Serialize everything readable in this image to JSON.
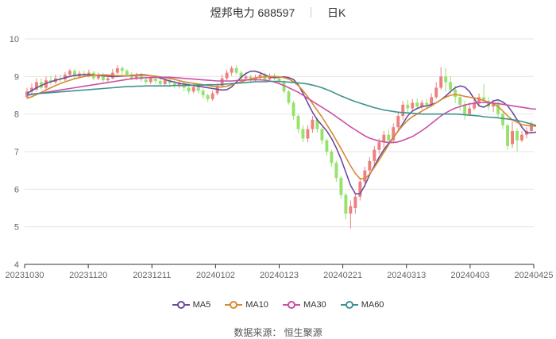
{
  "header": {
    "name": "煜邦电力",
    "code": "688597",
    "period": "日K"
  },
  "source": "数据来源： 恒生聚源",
  "colors": {
    "up": "#ee7f7f",
    "down": "#95e36b",
    "MA5": "#6a4c9c",
    "MA10": "#d9892f",
    "MA30": "#cc4fa6",
    "MA60": "#3f9290",
    "grid": "#e6e6e6",
    "axis": "#666666"
  },
  "chart_data": {
    "type": "candlestick",
    "title": "煜邦电力 688597 日K",
    "x_ticks": [
      "20231030",
      "20231120",
      "20231211",
      "20240102",
      "20240123",
      "20240221",
      "20240313",
      "20240403",
      "20240425"
    ],
    "ylim": [
      4,
      10
    ],
    "y_ticks": [
      4,
      5,
      6,
      7,
      8,
      9,
      10
    ],
    "grid": true,
    "legend_position": "bottom",
    "series": [
      {
        "name": "MA5",
        "values": [
          8.55,
          8.62,
          8.7,
          8.76,
          8.82,
          8.86,
          8.9,
          8.93,
          8.97,
          9.0,
          9.03,
          9.04,
          9.05,
          9.05,
          9.04,
          9.03,
          9.02,
          9.01,
          9.0,
          9.0,
          9.01,
          9.02,
          9.03,
          9.04,
          9.05,
          9.04,
          9.02,
          8.99,
          8.96,
          8.92,
          8.88,
          8.85,
          8.82,
          8.8,
          8.78,
          8.76,
          8.74,
          8.72,
          8.7,
          8.68,
          8.66,
          8.64,
          8.65,
          8.72,
          8.85,
          8.98,
          9.08,
          9.14,
          9.14,
          9.1,
          9.04,
          8.99,
          8.97,
          8.98,
          8.99,
          8.97,
          8.92,
          8.78,
          8.55,
          8.3,
          8.05,
          7.85,
          7.7,
          7.55,
          7.35,
          7.1,
          6.8,
          6.45,
          6.1,
          5.88,
          5.88,
          6.1,
          6.38,
          6.62,
          6.85,
          7.05,
          7.22,
          7.38,
          7.55,
          7.75,
          7.95,
          8.08,
          8.15,
          8.2,
          8.22,
          8.25,
          8.3,
          8.38,
          8.48,
          8.6,
          8.7,
          8.75,
          8.72,
          8.6,
          8.4,
          8.22,
          8.18,
          8.25,
          8.35,
          8.38,
          8.32,
          8.22,
          8.05,
          7.85,
          7.65,
          7.5,
          7.5,
          7.52
        ]
      },
      {
        "name": "MA10",
        "values": [
          8.42,
          8.46,
          8.52,
          8.58,
          8.64,
          8.7,
          8.76,
          8.81,
          8.86,
          8.9,
          8.94,
          8.97,
          9.0,
          9.02,
          9.03,
          9.04,
          9.04,
          9.04,
          9.03,
          9.02,
          9.02,
          9.02,
          9.02,
          9.03,
          9.03,
          9.03,
          9.02,
          9.01,
          8.99,
          8.97,
          8.95,
          8.92,
          8.89,
          8.86,
          8.84,
          8.82,
          8.8,
          8.78,
          8.76,
          8.74,
          8.72,
          8.72,
          8.74,
          8.78,
          8.82,
          8.86,
          8.9,
          8.93,
          8.96,
          8.98,
          8.99,
          9.0,
          9.0,
          8.99,
          8.97,
          8.93,
          8.86,
          8.76,
          8.62,
          8.46,
          8.28,
          8.1,
          7.92,
          7.72,
          7.52,
          7.3,
          7.08,
          6.85,
          6.62,
          6.42,
          6.28,
          6.28,
          6.4,
          6.58,
          6.78,
          6.98,
          7.18,
          7.38,
          7.55,
          7.7,
          7.83,
          7.93,
          8.0,
          8.08,
          8.15,
          8.22,
          8.3,
          8.38,
          8.45,
          8.5,
          8.52,
          8.5,
          8.47,
          8.45,
          8.43,
          8.4,
          8.36,
          8.32,
          8.28,
          8.2,
          8.08,
          7.95,
          7.85,
          7.78,
          7.72,
          7.7,
          7.68,
          7.68
        ]
      },
      {
        "name": "MA30",
        "values": [
          8.5,
          8.52,
          8.54,
          8.56,
          8.58,
          8.6,
          8.62,
          8.64,
          8.66,
          8.68,
          8.7,
          8.72,
          8.74,
          8.76,
          8.78,
          8.8,
          8.82,
          8.84,
          8.86,
          8.88,
          8.9,
          8.92,
          8.94,
          8.95,
          8.96,
          8.97,
          8.97,
          8.98,
          8.98,
          8.98,
          8.98,
          8.97,
          8.96,
          8.95,
          8.94,
          8.93,
          8.92,
          8.91,
          8.9,
          8.89,
          8.88,
          8.88,
          8.88,
          8.88,
          8.89,
          8.9,
          8.91,
          8.91,
          8.91,
          8.91,
          8.9,
          8.88,
          8.85,
          8.81,
          8.76,
          8.7,
          8.64,
          8.58,
          8.5,
          8.42,
          8.34,
          8.26,
          8.18,
          8.1,
          8.02,
          7.93,
          7.84,
          7.75,
          7.66,
          7.58,
          7.5,
          7.42,
          7.36,
          7.32,
          7.28,
          7.26,
          7.24,
          7.24,
          7.26,
          7.3,
          7.35,
          7.4,
          7.48,
          7.56,
          7.65,
          7.75,
          7.85,
          7.95,
          8.03,
          8.1,
          8.16,
          8.2,
          8.24,
          8.27,
          8.29,
          8.3,
          8.31,
          8.3,
          8.29,
          8.28,
          8.26,
          8.24,
          8.22,
          8.2,
          8.18,
          8.16,
          8.14,
          8.13
        ]
      },
      {
        "name": "MA60",
        "values": [
          8.52,
          8.53,
          8.54,
          8.55,
          8.56,
          8.57,
          8.58,
          8.59,
          8.6,
          8.61,
          8.62,
          8.63,
          8.64,
          8.65,
          8.66,
          8.67,
          8.68,
          8.69,
          8.7,
          8.71,
          8.72,
          8.73,
          8.73,
          8.74,
          8.74,
          8.75,
          8.75,
          8.75,
          8.75,
          8.75,
          8.75,
          8.76,
          8.76,
          8.76,
          8.76,
          8.77,
          8.77,
          8.77,
          8.78,
          8.78,
          8.78,
          8.79,
          8.8,
          8.81,
          8.82,
          8.83,
          8.84,
          8.85,
          8.86,
          8.86,
          8.86,
          8.87,
          8.87,
          8.87,
          8.86,
          8.85,
          8.84,
          8.83,
          8.82,
          8.8,
          8.77,
          8.74,
          8.7,
          8.65,
          8.6,
          8.54,
          8.48,
          8.43,
          8.38,
          8.33,
          8.29,
          8.25,
          8.21,
          8.17,
          8.14,
          8.11,
          8.09,
          8.07,
          8.05,
          8.04,
          8.03,
          8.02,
          8.01,
          8.0,
          8.0,
          8.0,
          8.0,
          8.0,
          8.0,
          8.0,
          8.0,
          7.99,
          7.98,
          7.97,
          7.96,
          7.95,
          7.93,
          7.92,
          7.91,
          7.9,
          7.88,
          7.87,
          7.85,
          7.83,
          7.8,
          7.77,
          7.73,
          7.7
        ]
      }
    ],
    "candles": [
      {
        "o": 8.45,
        "c": 8.6,
        "h": 8.7,
        "l": 8.4
      },
      {
        "o": 8.6,
        "c": 8.7,
        "h": 8.82,
        "l": 8.5
      },
      {
        "o": 8.65,
        "c": 8.85,
        "h": 8.95,
        "l": 8.6
      },
      {
        "o": 8.85,
        "c": 8.7,
        "h": 8.95,
        "l": 8.65
      },
      {
        "o": 8.7,
        "c": 8.9,
        "h": 9.0,
        "l": 8.65
      },
      {
        "o": 8.9,
        "c": 8.85,
        "h": 9.02,
        "l": 8.78
      },
      {
        "o": 8.85,
        "c": 8.95,
        "h": 9.05,
        "l": 8.8
      },
      {
        "o": 8.95,
        "c": 8.92,
        "h": 9.05,
        "l": 8.85
      },
      {
        "o": 8.92,
        "c": 9.05,
        "h": 9.12,
        "l": 8.88
      },
      {
        "o": 9.05,
        "c": 9.15,
        "h": 9.2,
        "l": 9.0
      },
      {
        "o": 9.15,
        "c": 9.0,
        "h": 9.2,
        "l": 8.95
      },
      {
        "o": 9.0,
        "c": 9.08,
        "h": 9.15,
        "l": 8.95
      },
      {
        "o": 9.08,
        "c": 9.02,
        "h": 9.15,
        "l": 8.98
      },
      {
        "o": 9.02,
        "c": 9.1,
        "h": 9.18,
        "l": 8.98
      },
      {
        "o": 9.1,
        "c": 8.95,
        "h": 9.15,
        "l": 8.9
      },
      {
        "o": 8.95,
        "c": 9.05,
        "h": 9.1,
        "l": 8.9
      },
      {
        "o": 9.05,
        "c": 8.9,
        "h": 9.1,
        "l": 8.85
      },
      {
        "o": 8.9,
        "c": 8.95,
        "h": 9.05,
        "l": 8.85
      },
      {
        "o": 8.95,
        "c": 9.1,
        "h": 9.2,
        "l": 8.92
      },
      {
        "o": 9.1,
        "c": 9.22,
        "h": 9.3,
        "l": 9.05
      },
      {
        "o": 9.22,
        "c": 9.15,
        "h": 9.28,
        "l": 9.05
      },
      {
        "o": 9.15,
        "c": 9.05,
        "h": 9.2,
        "l": 9.0
      },
      {
        "o": 9.05,
        "c": 8.95,
        "h": 9.12,
        "l": 8.9
      },
      {
        "o": 8.95,
        "c": 9.05,
        "h": 9.1,
        "l": 8.9
      },
      {
        "o": 9.05,
        "c": 8.92,
        "h": 9.1,
        "l": 8.85
      },
      {
        "o": 8.92,
        "c": 8.85,
        "h": 9.0,
        "l": 8.8
      },
      {
        "o": 8.85,
        "c": 8.95,
        "h": 9.02,
        "l": 8.8
      },
      {
        "o": 8.95,
        "c": 8.88,
        "h": 9.0,
        "l": 8.82
      },
      {
        "o": 8.88,
        "c": 8.8,
        "h": 8.95,
        "l": 8.75
      },
      {
        "o": 8.8,
        "c": 8.9,
        "h": 8.95,
        "l": 8.75
      },
      {
        "o": 8.9,
        "c": 8.82,
        "h": 8.95,
        "l": 8.72
      },
      {
        "o": 8.82,
        "c": 8.75,
        "h": 8.88,
        "l": 8.7
      },
      {
        "o": 8.75,
        "c": 8.82,
        "h": 8.9,
        "l": 8.68
      },
      {
        "o": 8.82,
        "c": 8.7,
        "h": 8.88,
        "l": 8.6
      },
      {
        "o": 8.7,
        "c": 8.6,
        "h": 8.75,
        "l": 8.52
      },
      {
        "o": 8.6,
        "c": 8.72,
        "h": 8.8,
        "l": 8.55
      },
      {
        "o": 8.72,
        "c": 8.62,
        "h": 8.78,
        "l": 8.55
      },
      {
        "o": 8.62,
        "c": 8.5,
        "h": 8.68,
        "l": 8.42
      },
      {
        "o": 8.5,
        "c": 8.4,
        "h": 8.55,
        "l": 8.32
      },
      {
        "o": 8.4,
        "c": 8.55,
        "h": 8.62,
        "l": 8.35
      },
      {
        "o": 8.55,
        "c": 8.75,
        "h": 8.82,
        "l": 8.5
      },
      {
        "o": 8.75,
        "c": 8.95,
        "h": 9.05,
        "l": 8.7
      },
      {
        "o": 8.95,
        "c": 9.1,
        "h": 9.18,
        "l": 8.9
      },
      {
        "o": 9.1,
        "c": 9.22,
        "h": 9.28,
        "l": 9.02
      },
      {
        "o": 9.22,
        "c": 9.1,
        "h": 9.3,
        "l": 9.05
      },
      {
        "o": 9.1,
        "c": 8.95,
        "h": 9.15,
        "l": 8.88
      },
      {
        "o": 8.95,
        "c": 9.0,
        "h": 9.08,
        "l": 8.9
      },
      {
        "o": 9.0,
        "c": 8.9,
        "h": 9.05,
        "l": 8.82
      },
      {
        "o": 8.9,
        "c": 8.98,
        "h": 9.05,
        "l": 8.85
      },
      {
        "o": 8.98,
        "c": 9.05,
        "h": 9.12,
        "l": 8.92
      },
      {
        "o": 9.05,
        "c": 8.92,
        "h": 9.1,
        "l": 8.88
      },
      {
        "o": 8.92,
        "c": 9.0,
        "h": 9.08,
        "l": 8.88
      },
      {
        "o": 9.0,
        "c": 8.95,
        "h": 9.08,
        "l": 8.9
      },
      {
        "o": 8.95,
        "c": 8.85,
        "h": 9.0,
        "l": 8.8
      },
      {
        "o": 8.85,
        "c": 8.6,
        "h": 8.9,
        "l": 8.55
      },
      {
        "o": 8.6,
        "c": 8.3,
        "h": 8.65,
        "l": 8.25
      },
      {
        "o": 8.3,
        "c": 7.95,
        "h": 8.35,
        "l": 7.85
      },
      {
        "o": 7.95,
        "c": 7.6,
        "h": 8.0,
        "l": 7.5
      },
      {
        "o": 7.6,
        "c": 7.35,
        "h": 7.7,
        "l": 7.25
      },
      {
        "o": 7.35,
        "c": 7.6,
        "h": 7.7,
        "l": 7.25
      },
      {
        "o": 7.6,
        "c": 7.85,
        "h": 7.95,
        "l": 7.5
      },
      {
        "o": 7.85,
        "c": 7.6,
        "h": 7.9,
        "l": 7.5
      },
      {
        "o": 7.6,
        "c": 7.3,
        "h": 7.65,
        "l": 7.2
      },
      {
        "o": 7.3,
        "c": 7.0,
        "h": 7.35,
        "l": 6.9
      },
      {
        "o": 7.0,
        "c": 6.7,
        "h": 7.05,
        "l": 6.6
      },
      {
        "o": 6.7,
        "c": 6.3,
        "h": 6.75,
        "l": 6.2
      },
      {
        "o": 6.3,
        "c": 5.85,
        "h": 6.35,
        "l": 5.75
      },
      {
        "o": 5.85,
        "c": 5.35,
        "h": 5.9,
        "l": 5.2
      },
      {
        "o": 5.35,
        "c": 5.55,
        "h": 5.7,
        "l": 4.95
      },
      {
        "o": 5.5,
        "c": 5.8,
        "h": 5.9,
        "l": 5.35
      },
      {
        "o": 5.8,
        "c": 6.2,
        "h": 6.3,
        "l": 5.7
      },
      {
        "o": 6.2,
        "c": 6.5,
        "h": 6.6,
        "l": 6.05
      },
      {
        "o": 6.5,
        "c": 6.75,
        "h": 6.85,
        "l": 6.4
      },
      {
        "o": 6.75,
        "c": 7.05,
        "h": 7.15,
        "l": 6.65
      },
      {
        "o": 7.05,
        "c": 7.25,
        "h": 7.35,
        "l": 6.95
      },
      {
        "o": 7.25,
        "c": 7.45,
        "h": 7.55,
        "l": 7.1
      },
      {
        "o": 7.45,
        "c": 7.3,
        "h": 7.6,
        "l": 7.2
      },
      {
        "o": 7.3,
        "c": 7.65,
        "h": 7.75,
        "l": 7.25
      },
      {
        "o": 7.65,
        "c": 7.95,
        "h": 8.05,
        "l": 7.55
      },
      {
        "o": 7.95,
        "c": 8.25,
        "h": 8.35,
        "l": 7.85
      },
      {
        "o": 8.25,
        "c": 8.15,
        "h": 8.38,
        "l": 8.05
      },
      {
        "o": 8.15,
        "c": 8.3,
        "h": 8.4,
        "l": 8.1
      },
      {
        "o": 8.3,
        "c": 8.2,
        "h": 8.42,
        "l": 8.12
      },
      {
        "o": 8.2,
        "c": 8.3,
        "h": 8.38,
        "l": 8.12
      },
      {
        "o": 8.3,
        "c": 8.25,
        "h": 8.4,
        "l": 8.15
      },
      {
        "o": 8.25,
        "c": 8.45,
        "h": 8.55,
        "l": 8.2
      },
      {
        "o": 8.45,
        "c": 8.7,
        "h": 8.85,
        "l": 8.4
      },
      {
        "o": 8.7,
        "c": 9.0,
        "h": 9.25,
        "l": 8.65
      },
      {
        "o": 9.0,
        "c": 8.85,
        "h": 9.22,
        "l": 8.6
      },
      {
        "o": 8.85,
        "c": 8.65,
        "h": 9.0,
        "l": 8.55
      },
      {
        "o": 8.65,
        "c": 8.45,
        "h": 8.75,
        "l": 8.3
      },
      {
        "o": 8.45,
        "c": 8.25,
        "h": 8.55,
        "l": 8.1
      },
      {
        "o": 8.25,
        "c": 8.0,
        "h": 8.35,
        "l": 7.85
      },
      {
        "o": 8.0,
        "c": 8.15,
        "h": 8.3,
        "l": 7.95
      },
      {
        "o": 8.15,
        "c": 8.3,
        "h": 8.45,
        "l": 8.1
      },
      {
        "o": 8.3,
        "c": 8.45,
        "h": 8.55,
        "l": 8.2
      },
      {
        "o": 8.45,
        "c": 8.35,
        "h": 8.8,
        "l": 8.3
      },
      {
        "o": 8.35,
        "c": 8.2,
        "h": 8.45,
        "l": 8.1
      },
      {
        "o": 8.2,
        "c": 8.3,
        "h": 8.38,
        "l": 8.05
      },
      {
        "o": 8.3,
        "c": 8.0,
        "h": 8.35,
        "l": 7.9
      },
      {
        "o": 8.0,
        "c": 7.7,
        "h": 8.05,
        "l": 7.6
      },
      {
        "o": 7.7,
        "c": 7.15,
        "h": 7.75,
        "l": 7.05
      },
      {
        "o": 7.2,
        "c": 7.55,
        "h": 7.8,
        "l": 7.1
      },
      {
        "o": 7.55,
        "c": 7.3,
        "h": 7.62,
        "l": 7.0
      },
      {
        "o": 7.3,
        "c": 7.45,
        "h": 7.55,
        "l": 7.25
      },
      {
        "o": 7.45,
        "c": 7.55,
        "h": 7.65,
        "l": 7.35
      },
      {
        "o": 7.55,
        "c": 7.75,
        "h": 7.8,
        "l": 7.5
      }
    ]
  },
  "legend": [
    {
      "label": "MA5",
      "color": "#6a4c9c"
    },
    {
      "label": "MA10",
      "color": "#d9892f"
    },
    {
      "label": "MA30",
      "color": "#cc4fa6"
    },
    {
      "label": "MA60",
      "color": "#3f9290"
    }
  ]
}
